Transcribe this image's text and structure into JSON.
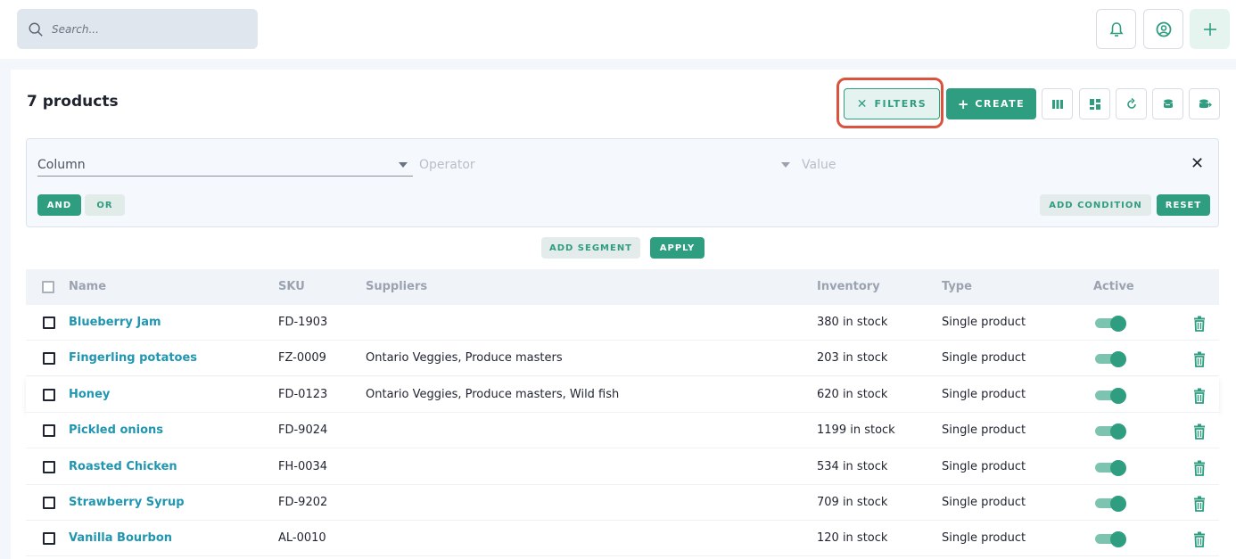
{
  "search": {
    "placeholder": "Search..."
  },
  "header": {
    "count_label": "7 products"
  },
  "toolbar": {
    "filters_label": "FILTERS",
    "create_label": "CREATE"
  },
  "filter": {
    "column_placeholder": "Column",
    "operator_placeholder": "Operator",
    "value_placeholder": "Value",
    "and_label": "AND",
    "or_label": "OR",
    "add_condition_label": "ADD CONDITION",
    "reset_label": "RESET",
    "add_segment_label": "ADD SEGMENT",
    "apply_label": "APPLY"
  },
  "table": {
    "columns": [
      "Name",
      "SKU",
      "Suppliers",
      "Inventory",
      "Type",
      "Active"
    ],
    "rows": [
      {
        "name": "Blueberry Jam",
        "sku": "FD-1903",
        "suppliers": "",
        "inventory": "380 in stock",
        "type": "Single product",
        "active": true
      },
      {
        "name": "Fingerling potatoes",
        "sku": "FZ-0009",
        "suppliers": "Ontario Veggies, Produce masters",
        "inventory": "203 in stock",
        "type": "Single product",
        "active": true
      },
      {
        "name": "Honey",
        "sku": "FD-0123",
        "suppliers": "Ontario Veggies, Produce masters, Wild fish",
        "inventory": "620 in stock",
        "type": "Single product",
        "active": true
      },
      {
        "name": "Pickled onions",
        "sku": "FD-9024",
        "suppliers": "",
        "inventory": "1199 in stock",
        "type": "Single product",
        "active": true
      },
      {
        "name": "Roasted Chicken",
        "sku": "FH-0034",
        "suppliers": "",
        "inventory": "534 in stock",
        "type": "Single product",
        "active": true
      },
      {
        "name": "Strawberry Syrup",
        "sku": "FD-9202",
        "suppliers": "",
        "inventory": "709 in stock",
        "type": "Single product",
        "active": true
      },
      {
        "name": "Vanilla Bourbon",
        "sku": "AL-0010",
        "suppliers": "",
        "inventory": "120 in stock",
        "type": "Single product",
        "active": true
      }
    ]
  },
  "colors": {
    "accent": "#2f9d80",
    "link": "#2196b0",
    "highlight": "#d9533f"
  }
}
